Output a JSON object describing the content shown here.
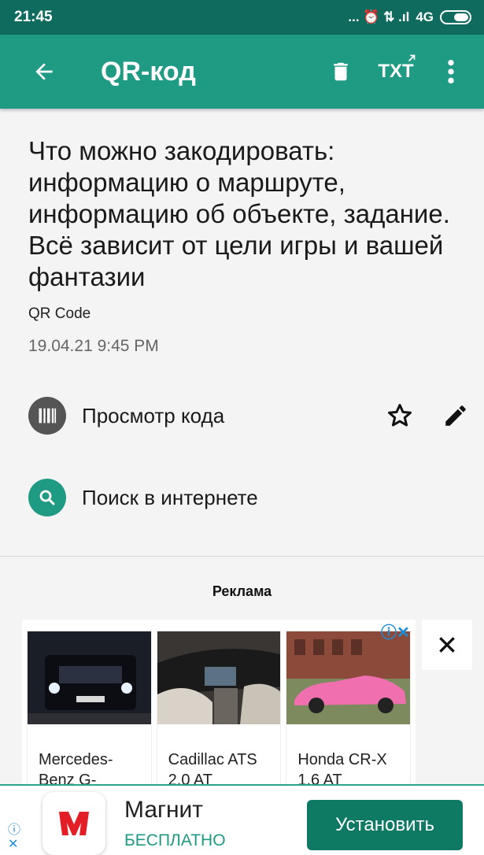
{
  "status_bar": {
    "time": "21:45",
    "indicators": "... ⏰ ⇅ .ıl",
    "network": "4G"
  },
  "app_bar": {
    "title": "QR-код",
    "txt_label": "TXT",
    "icons": [
      "arrow-back-icon",
      "trash-icon",
      "txt-export-icon",
      "more-vert-icon"
    ]
  },
  "qr": {
    "text": "Что можно закодировать: информацию о маршруте, информацию об объекте, задание. Всё зависит от цели игры и вашей фантазии",
    "type": "QR Code",
    "date": "19.04.21 9:45 PM"
  },
  "actions": {
    "view_code": "Просмотр кода",
    "search_web": "Поиск в интернете"
  },
  "ad": {
    "header": "Реклама",
    "cards": [
      {
        "title": "Mercedes-Benz G-",
        "image": "black-suv-photo"
      },
      {
        "title": "Cadillac ATS 2.0 AT",
        "image": "car-interior-photo"
      },
      {
        "title": "Honda CR-X 1.6 AT",
        "image": "pink-coupe-photo"
      }
    ]
  },
  "banner": {
    "app_name": "Магнит",
    "price": "БЕСПЛАТНО",
    "install": "Установить",
    "logo_text": "M"
  },
  "colors": {
    "status_bar": "#0f6b5e",
    "app_bar": "#1f9a83",
    "accent": "#1f9a83",
    "install_button": "#0f7a63",
    "magnit_red": "#e41e26"
  }
}
